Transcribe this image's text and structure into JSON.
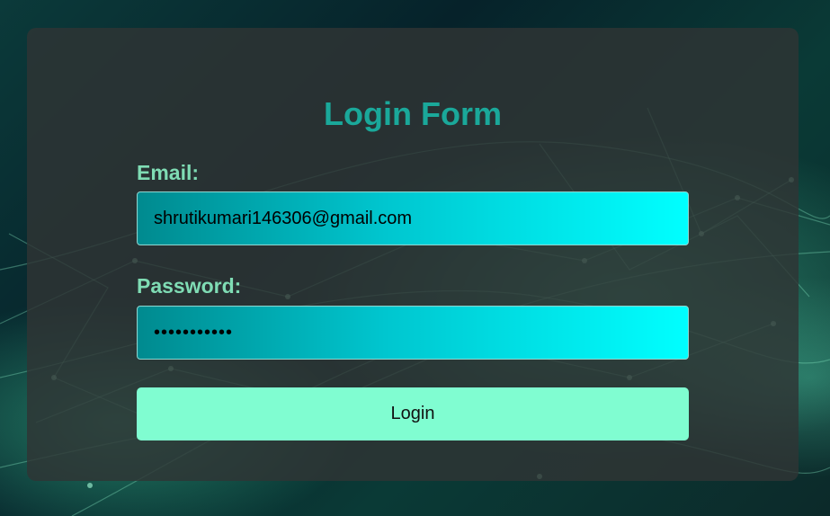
{
  "form": {
    "title": "Login Form",
    "email_label": "Email:",
    "email_value": "shrutikumari146306@gmail.com",
    "password_label": "Password:",
    "password_value": "•••••••••••",
    "login_label": "Login"
  },
  "colors": {
    "title": "#1aa89a",
    "label": "#7fdcb4",
    "button": "#80fdd1",
    "input_gradient_start": "#008a8f",
    "input_gradient_end": "#00ffff"
  }
}
